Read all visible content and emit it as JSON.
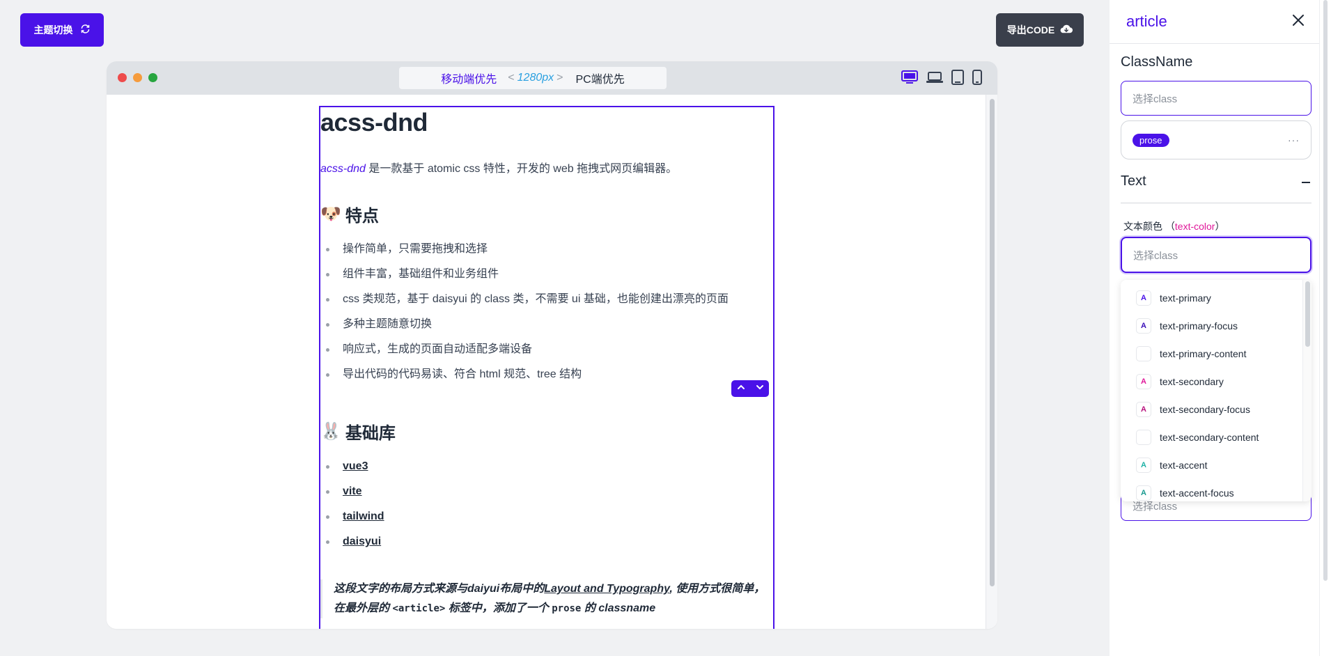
{
  "toolbar": {
    "theme_button": "主题切换",
    "export_button": "导出CODE"
  },
  "browser": {
    "url_mobile": "移动端优先",
    "url_left_chevron": "<",
    "url_breakpoint": "1280px",
    "url_right_chevron": ">",
    "url_pc": "PC端优先",
    "devices": [
      "desktop-icon",
      "laptop-icon",
      "tablet-icon",
      "phone-icon"
    ]
  },
  "article": {
    "title": "acss-dnd",
    "intro_em": "acss-dnd",
    "intro_text": " 是一款基于 atomic css 特性，开发的 web 拖拽式网页编辑器。",
    "features_emoji": "🐶",
    "features_title": "特点",
    "features": [
      "操作简单，只需要拖拽和选择",
      "组件丰富，基础组件和业务组件",
      "css 类规范，基于 daisyui 的 class 类，不需要 ui 基础，也能创建出漂亮的页面",
      "多种主题随意切换",
      "响应式，生成的页面自动适配多端设备",
      "导出代码的代码易读、符合 html 规范、tree 结构"
    ],
    "libs_emoji": "🐰",
    "libs_title": "基础库",
    "libs": [
      "vue3",
      "vite",
      "tailwind",
      "daisyui"
    ],
    "quote_part1": "这段文字的布局方式来源与daiyui布局中的",
    "quote_link": "Layout and Typography",
    "quote_part2": ", 使用方式很简单，在最外层的 ",
    "quote_code1": "<article>",
    "quote_part3": " 标签中，添加了一个 ",
    "quote_code2": "prose",
    "quote_part4": " 的 classname"
  },
  "panel": {
    "title": "article",
    "classname_label": "ClassName",
    "classname_placeholder": "选择class",
    "tag": "prose",
    "tag_more": "···",
    "text_section": "Text",
    "color_label": "文本颜色",
    "color_key_open": "（",
    "color_key": "text-color",
    "color_key_close": "）",
    "color_placeholder": "选择class",
    "below_placeholder": "选择class",
    "options": [
      {
        "label": "text-primary",
        "color": "#4a12e8",
        "glyph": "A"
      },
      {
        "label": "text-primary-focus",
        "color": "#3a0fb8",
        "glyph": "A"
      },
      {
        "label": "text-primary-content",
        "color": "#ffffff",
        "glyph": ""
      },
      {
        "label": "text-secondary",
        "color": "#e0189a",
        "glyph": "A"
      },
      {
        "label": "text-secondary-focus",
        "color": "#b8127d",
        "glyph": "A"
      },
      {
        "label": "text-secondary-content",
        "color": "#ffffff",
        "glyph": ""
      },
      {
        "label": "text-accent",
        "color": "#1fb2a6",
        "glyph": "A"
      },
      {
        "label": "text-accent-focus",
        "color": "#199a8f",
        "glyph": "A"
      }
    ]
  },
  "colors": {
    "primary": "#4a12e8",
    "secondary": "#e0189a",
    "accent": "#1fb2a6",
    "dark_button": "#3a3f4b"
  }
}
